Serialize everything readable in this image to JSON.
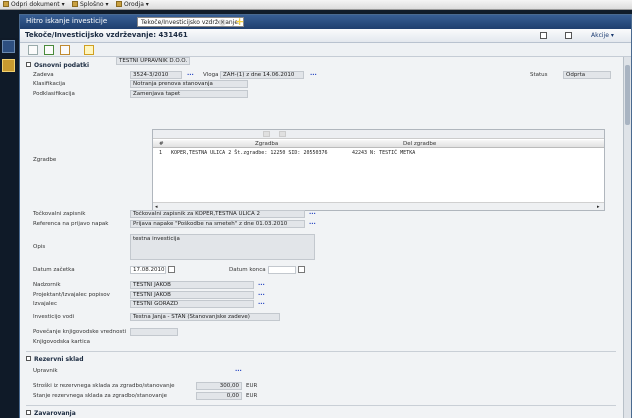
{
  "top_menu": [
    {
      "label": "Odpri dokument",
      "icon": "document-icon"
    },
    {
      "label": "Splošno",
      "icon": "general-icon"
    },
    {
      "label": "Orodja",
      "icon": "tools-icon"
    }
  ],
  "window": {
    "title": "Hitro iskanje investicije",
    "tab_label": "Tekoče/Investicijsko vzdrževanje:",
    "page_title": "Tekoče/Investicijsko vzdrževanje: 431461",
    "actions_label": "Akcije"
  },
  "sections": {
    "basic": "Osnovni podatki",
    "reserve": "Rezervni sklad",
    "insurance": "Zavarovanja"
  },
  "form": {
    "zadeva_label": "Zadeva",
    "zadeva_value": "3524-3/2010",
    "vloga_label": "Vloga",
    "vloga_value": "ZAH-(1) z dne 14.06.2010",
    "status_label": "Status",
    "status_value": "Odprta",
    "klasifikacija_label": "Klasifikacija",
    "klasifikacija_value": "Notranja prenova stanovanja",
    "podklasifikacija_label": "Podklasifikacija",
    "podklasifikacija_value": "Zamenjava tapet",
    "zgradbe_label": "Zgradbe",
    "grid_headers": [
      "#",
      "Zgradba",
      "Del zgradbe"
    ],
    "grid_rows": [
      {
        "num": "1",
        "zgradba": "KOPER,TESTNA ULICA 2 Št.zgradbe: 12250 SID: 20550376",
        "del": "42243 N: TESTIĆ METKA"
      }
    ],
    "tockovalni_label": "Točkovalni zapisnik",
    "tockovalni_value": "Točkovalni zapisnik za KOPER,TESTNA ULICA 2",
    "referenca_label": "Referenca na prijavo napak",
    "referenca_value": "Prijava napake \"Poškodbe na smeteh\" z dne 01.03.2010",
    "opis_label": "Opis",
    "opis_value": "testna investicija",
    "datum_zacetka_label": "Datum začetka",
    "datum_zacetka_value": "17.08.2010",
    "datum_konca_label": "Datum konca",
    "datum_konca_value": "",
    "nadzornik_label": "Nadzornik",
    "nadzornik_value": "TESTNI JAKOB",
    "projektant_label": "Projektant/Izvajalec popisov",
    "projektant_value": "TESTNI JAKOB",
    "izvajalec_label": "Izvajalec",
    "izvajalec_value": "TESTNI GORAZD",
    "investicijo_vodi_label": "Investicijo vodi",
    "investicijo_vodi_value": "Testna Janja - STAN (Stanovanjske zadeve)",
    "povecanje_label": "Povečanje knjigovodske vrednosti",
    "povecanje_value": "",
    "kartica_label": "Knjigovodska kartica"
  },
  "reserve": {
    "upravnik_label": "Upravnik",
    "upravnik_value": "TESTNI UPRAVNIK D.O.O.",
    "stroski_label": "Stroški iz rezervnega sklada za zgradbo/stanovanje",
    "stroski_value": "300,00",
    "stroski_unit": "EUR",
    "stanje_label": "Stanje rezervnega sklada za zgradbo/stanovanje",
    "stanje_value": "0,00",
    "stanje_unit": "EUR"
  },
  "more_dots": "..."
}
